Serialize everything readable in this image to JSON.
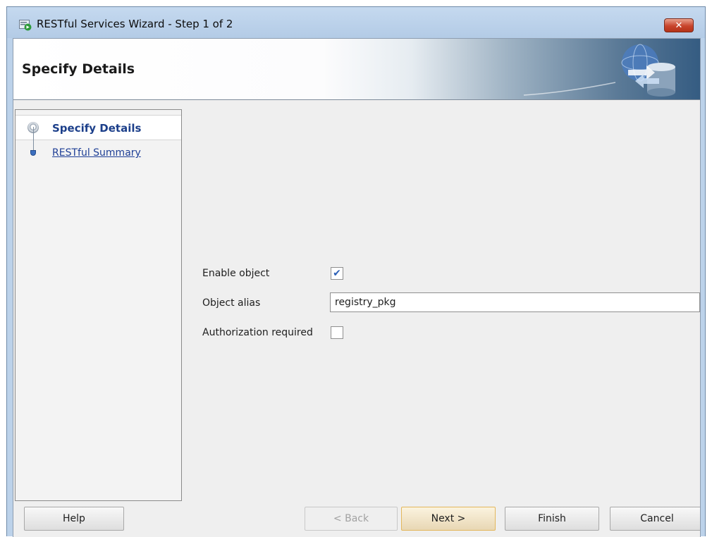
{
  "window": {
    "title": "RESTful Services Wizard - Step 1 of 2",
    "close_glyph": "✕"
  },
  "banner": {
    "title": "Specify Details"
  },
  "steps": [
    {
      "label": "Specify Details",
      "state": "current"
    },
    {
      "label": "RESTful Summary",
      "state": "link"
    }
  ],
  "form": {
    "enable_object_label": "Enable object",
    "enable_object_checked": true,
    "object_alias_label": "Object alias",
    "object_alias_value": "registry_pkg",
    "authorization_label": "Authorization required",
    "authorization_checked": false
  },
  "buttons": {
    "help": "Help",
    "back": "< Back",
    "next": "Next >",
    "finish": "Finish",
    "cancel": "Cancel"
  },
  "colors": {
    "titlebar": "#bcd2ea",
    "link": "#1f3f96",
    "checkmark": "#2b5fb6",
    "default_button_border": "#e3b75c"
  }
}
